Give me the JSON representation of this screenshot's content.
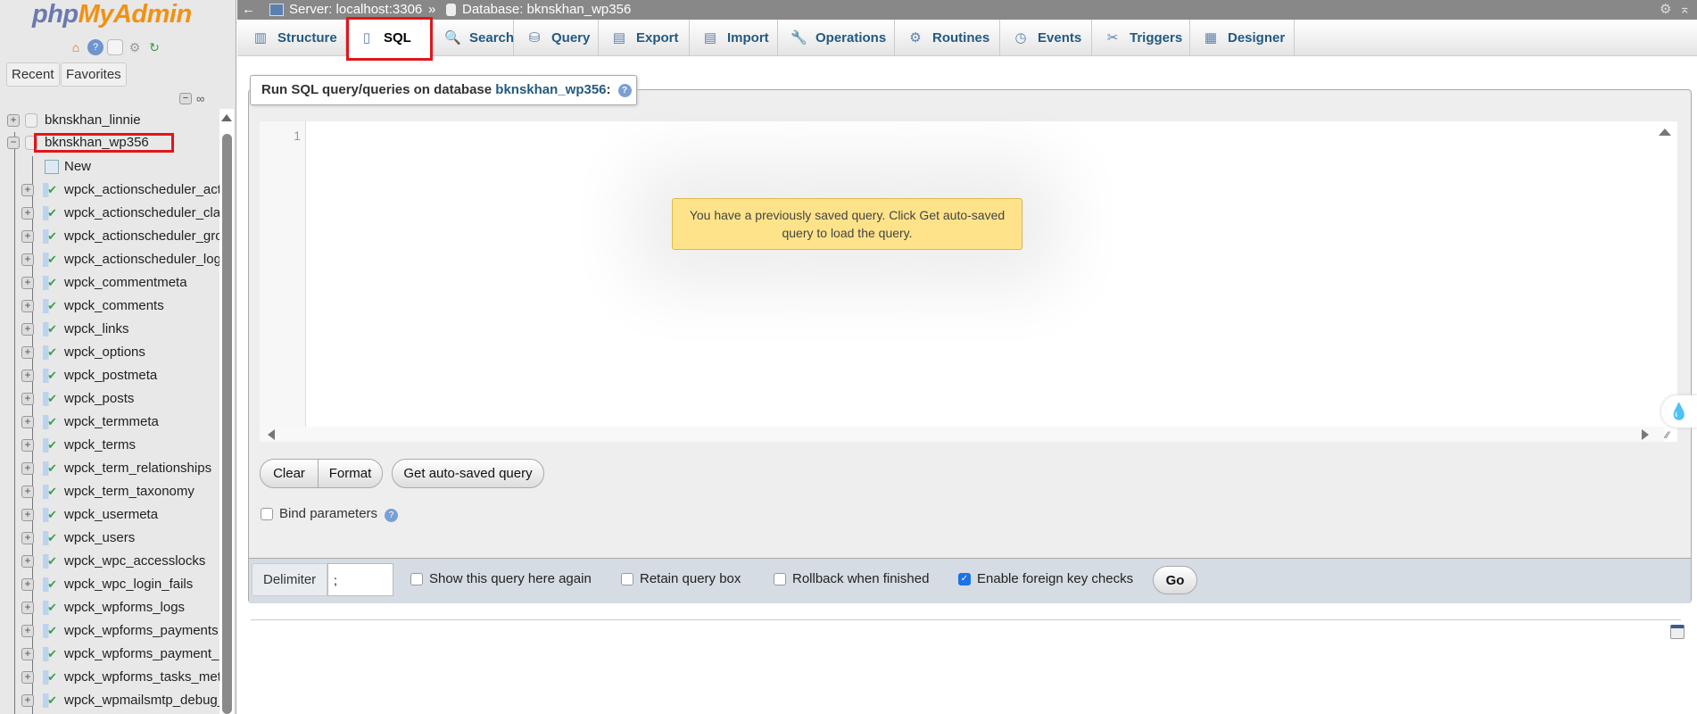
{
  "sidebar": {
    "logo": {
      "php": "php",
      "myadmin": "MyAdmin"
    },
    "quick_icons": [
      "home-icon",
      "help-icon",
      "docs-icon",
      "settings-icon",
      "reload-icon"
    ],
    "recent_label": "Recent",
    "favorites_label": "Favorites",
    "databases": [
      {
        "name": "bknskhan_linnie",
        "expanded": false
      },
      {
        "name": "bknskhan_wp356",
        "expanded": true,
        "highlighted": true
      }
    ],
    "new_label": "New",
    "tables": [
      "wpck_actionscheduler_act",
      "wpck_actionscheduler_cla",
      "wpck_actionscheduler_gro",
      "wpck_actionscheduler_log",
      "wpck_commentmeta",
      "wpck_comments",
      "wpck_links",
      "wpck_options",
      "wpck_postmeta",
      "wpck_posts",
      "wpck_termmeta",
      "wpck_terms",
      "wpck_term_relationships",
      "wpck_term_taxonomy",
      "wpck_usermeta",
      "wpck_users",
      "wpck_wpc_accesslocks",
      "wpck_wpc_login_fails",
      "wpck_wpforms_logs",
      "wpck_wpforms_payments",
      "wpck_wpforms_payment_r",
      "wpck_wpforms_tasks_met",
      "wpck_wpmailsmtp_debug_"
    ]
  },
  "breadcrumb": {
    "back": "←",
    "server": "Server: localhost:3306",
    "sep": "»",
    "database": "Database: bknskhan_wp356"
  },
  "tabs": [
    {
      "label": "Structure",
      "icon": "structure-icon"
    },
    {
      "label": "SQL",
      "icon": "sql-icon",
      "active": true
    },
    {
      "label": "Search",
      "icon": "search-icon"
    },
    {
      "label": "Query",
      "icon": "query-icon"
    },
    {
      "label": "Export",
      "icon": "export-icon"
    },
    {
      "label": "Import",
      "icon": "import-icon"
    },
    {
      "label": "Operations",
      "icon": "operations-icon"
    },
    {
      "label": "Routines",
      "icon": "routines-icon"
    },
    {
      "label": "Events",
      "icon": "events-icon"
    },
    {
      "label": "Triggers",
      "icon": "triggers-icon"
    },
    {
      "label": "Designer",
      "icon": "designer-icon"
    }
  ],
  "sql": {
    "legend_prefix": "Run SQL query/queries on database ",
    "legend_db": "bknskhan_wp356",
    "legend_suffix": ":",
    "line_number": "1",
    "query_value": "",
    "tooltip": "You have a previously saved query. Click Get auto-saved query to load the query.",
    "clear": "Clear",
    "format": "Format",
    "get_autosaved": "Get auto-saved query",
    "bind_parameters": "Bind parameters",
    "delimiter_label": "Delimiter",
    "delimiter_value": ";",
    "options": [
      {
        "label": "Show this query here again",
        "checked": false
      },
      {
        "label": "Retain query box",
        "checked": false
      },
      {
        "label": "Rollback when finished",
        "checked": false
      },
      {
        "label": "Enable foreign key checks",
        "checked": true
      }
    ],
    "go": "Go"
  },
  "colors": {
    "link": "#235a81",
    "tooltip_bg": "#ffe38a",
    "highlight": "#e0161a",
    "footer_bg": "#d5dce3"
  }
}
